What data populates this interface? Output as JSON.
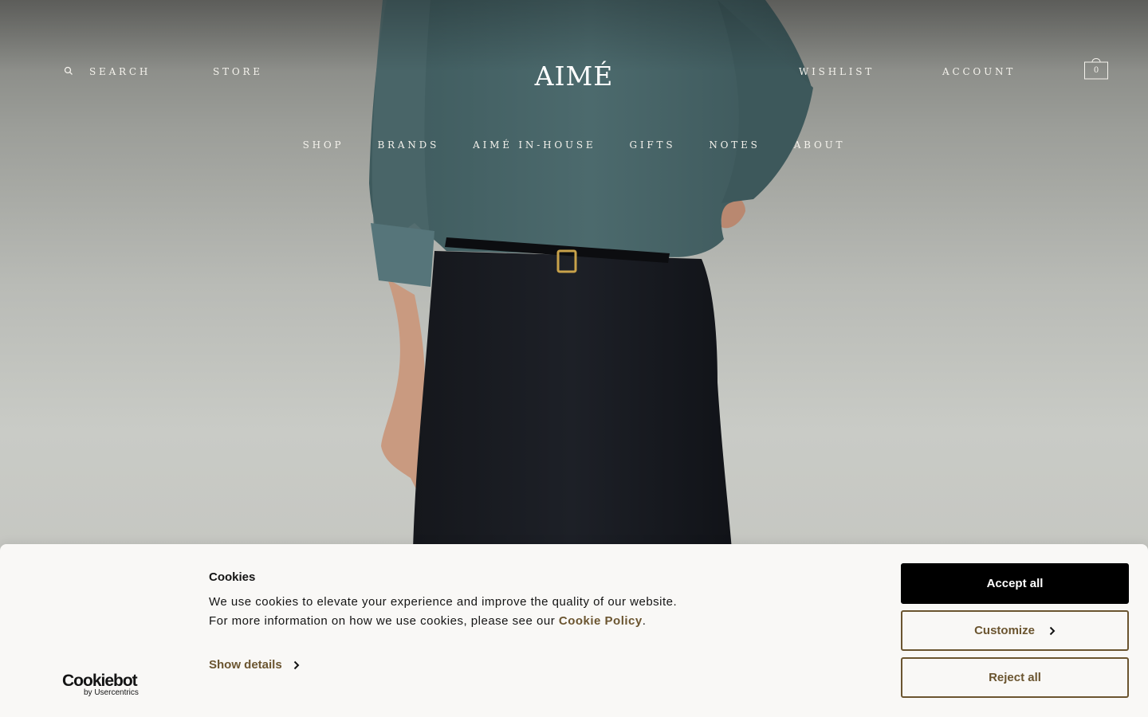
{
  "header": {
    "search_label": "SEARCH",
    "store_label": "STORE",
    "logo_text": "AIMÉ",
    "wishlist_label": "WISHLIST",
    "account_label": "ACCOUNT",
    "cart_count": "0",
    "icons": {
      "search": "search-icon",
      "cart": "shopping-bag-icon"
    }
  },
  "main_nav": {
    "items": [
      {
        "label": "SHOP"
      },
      {
        "label": "BRANDS"
      },
      {
        "label": "AIMÉ IN-HOUSE"
      },
      {
        "label": "GIFTS"
      },
      {
        "label": "NOTES"
      },
      {
        "label": "ABOUT"
      }
    ]
  },
  "hero": {
    "image": "model-sweater-trousers-photo"
  },
  "cookie_banner": {
    "provider_name": "Cookiebot",
    "provider_sub": "by Usercentrics",
    "title": "Cookies",
    "text_line1": "We use cookies to elevate your experience and improve the quality of our website.",
    "text_line2_before": "For more information on how we use cookies, please see our ",
    "policy_link": "Cookie Policy",
    "text_line2_after": ".",
    "show_details_label": "Show details",
    "accept_label": "Accept all",
    "customize_label": "Customize",
    "reject_label": "Reject all",
    "colors": {
      "accent": "#6b5530",
      "primary_button": "#000000",
      "background": "#f9f8f6"
    }
  }
}
